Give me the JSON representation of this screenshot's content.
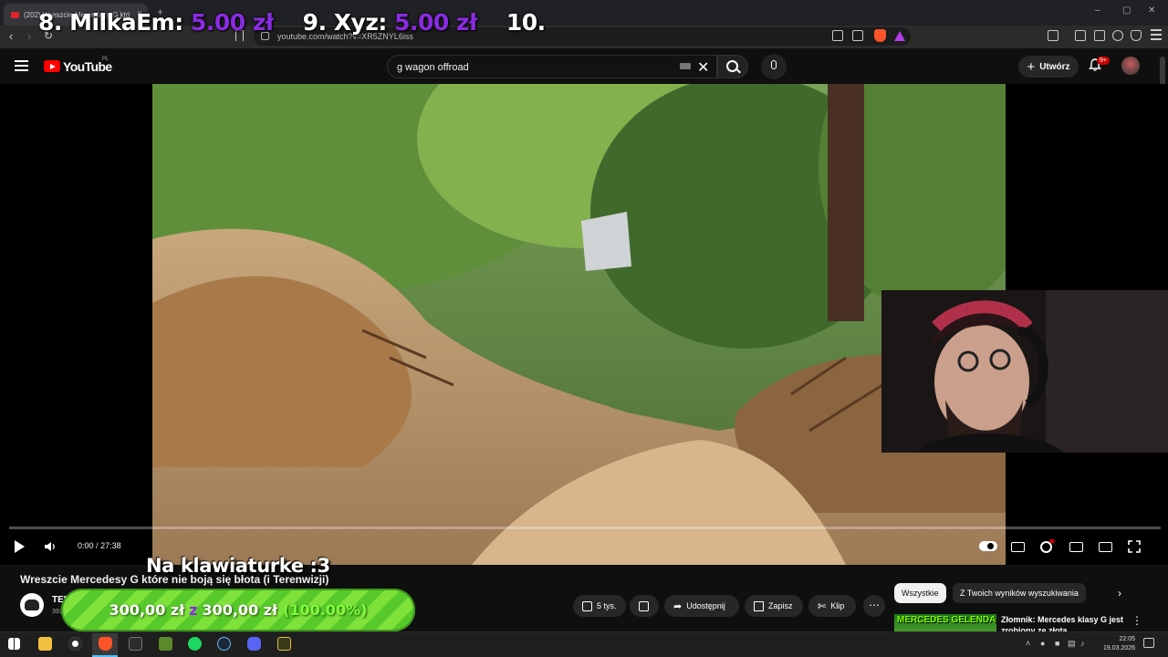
{
  "browser": {
    "tab_title": "(202) Wreszcie Mercedesy G któ",
    "tab_close": "×",
    "new_tab": "+",
    "url": "youtube.com/watch?v=XR5ZNYL6iss",
    "window_controls": [
      "–",
      "▢",
      "✕"
    ]
  },
  "overlay": {
    "donors": [
      {
        "name": "8. MilkaEm:",
        "amount": "5.00 zł"
      },
      {
        "name": "9. Xyz:",
        "amount": "5.00 zł"
      },
      {
        "name": "10.",
        "amount": ""
      }
    ],
    "caption": "Na klawiaturke :3",
    "goal": {
      "current": "300,00 zł",
      "sep": "z",
      "target": "300,00 zł",
      "percent": "(100.00%)"
    }
  },
  "youtube": {
    "logo_text": "YouTube",
    "logo_region": "PL",
    "search_value": "g wagon offroad",
    "create_label": "Utwórz",
    "notif_badge": "9+"
  },
  "player": {
    "time_current": "0:00",
    "time_sep": "/",
    "time_total": "27:38",
    "progress": 0.0
  },
  "video": {
    "title": "Wreszcie Mercedesy G które nie boją się błota (i Terenwizji)",
    "channel": "TERENWIZJA",
    "subs": "393",
    "actions": {
      "likes": "5 tys.",
      "share": "Udostępnij",
      "save": "Zapisz",
      "clip": "Klip",
      "more": "⋯"
    }
  },
  "sidebar": {
    "chips": [
      "Wszystkie",
      "Z Twoich wyników wyszukiwania"
    ],
    "suggestion": {
      "thumb_text": "MERCEDES GELENDA",
      "title": "Złomnik: Mercedes klasy G jest zrobiony ze złota"
    }
  },
  "taskbar": {
    "time": "22:05",
    "date": "19.03.2026"
  },
  "colors": {
    "accent_purple": "#8a2be2",
    "goal_green": "#58c92a",
    "yt_red": "#ff0000"
  }
}
